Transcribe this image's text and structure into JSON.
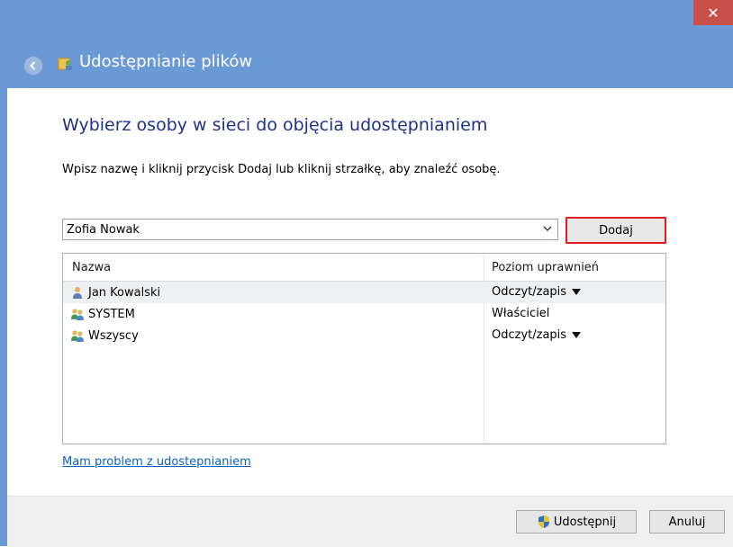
{
  "window": {
    "title": "Udostępnianie plików",
    "close_glyph": "✕"
  },
  "main": {
    "heading": "Wybierz osoby w sieci do objęcia udostępnianiem",
    "instruction": "Wpisz nazwę i kliknij przycisk Dodaj lub kliknij strzałkę, aby znaleźć osobę.",
    "name_input_value": "Zofia Nowak",
    "add_button_label": "Dodaj"
  },
  "list": {
    "columns": {
      "name": "Nazwa",
      "permission": "Poziom uprawnień"
    },
    "rows": [
      {
        "name": "Jan Kowalski",
        "permission": "Odczyt/zapis",
        "icon": "user-icon",
        "has_dropdown": true
      },
      {
        "name": "SYSTEM",
        "permission": "Właściciel",
        "icon": "user-group-icon",
        "has_dropdown": false
      },
      {
        "name": "Wszyscy",
        "permission": "Odczyt/zapis",
        "icon": "user-group-icon",
        "has_dropdown": true
      }
    ]
  },
  "help_link": "Mam problem z udostepnianiem",
  "footer": {
    "share_label": "Udostępnij",
    "cancel_label": "Anuluj"
  },
  "colors": {
    "title_bar": "#6b99d6",
    "heading": "#1e3287",
    "link": "#0a62c4",
    "highlight_border": "#e02020"
  }
}
